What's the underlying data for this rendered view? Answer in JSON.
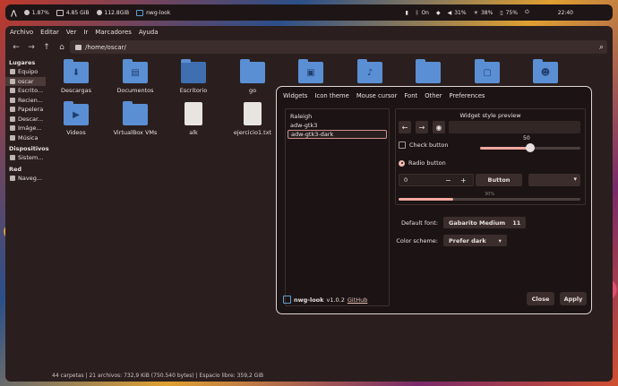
{
  "topbar": {
    "cpu": "1.87%",
    "memory": "4.85 GiB",
    "disk": "112.8GiB",
    "window_title": "nwg-look",
    "bluetooth": "On",
    "volume": "31%",
    "brightness": "38%",
    "battery": "75%",
    "clock": "22:40"
  },
  "filemanager": {
    "menu": [
      "Archivo",
      "Editar",
      "Ver",
      "Ir",
      "Marcadores",
      "Ayuda"
    ],
    "path": "/home/oscar/",
    "sidebar": {
      "places_header": "Lugares",
      "places": [
        "Equipo",
        "oscar",
        "Escrito...",
        "Recien...",
        "Papelera",
        "Descar...",
        "Imáge...",
        "Música"
      ],
      "devices_header": "Dispositivos",
      "devices": [
        "Sistem..."
      ],
      "network_header": "Red",
      "network": [
        "Naveg..."
      ]
    },
    "files": [
      "Descargas",
      "Documentos",
      "Escritorio",
      "go",
      "",
      "",
      "",
      "",
      "",
      "Videos",
      "VirtualBox VMs",
      "alk",
      "ejercicio1.txt"
    ],
    "status": "44 carpetas  |  21 archivos: 732,9 KiB (750.540 bytes)  |  Espacio libre: 359,2 GiB"
  },
  "dialog": {
    "tabs": [
      "Widgets",
      "Icon theme",
      "Mouse cursor",
      "Font",
      "Other",
      "Preferences"
    ],
    "themes": [
      "Raleigh",
      "adw-gtk3",
      "adw-gtk3-dark"
    ],
    "selected_theme_index": 2,
    "preview": {
      "title": "Widget style preview",
      "check_label": "Check button",
      "radio_label": "Radio button",
      "scale_value": "50",
      "scale_fraction": 0.5,
      "spin_value": "0",
      "button_label": "Button",
      "progress_label": "30%",
      "progress_fraction": 0.3
    },
    "default_font_label": "Default font:",
    "default_font_name": "Gabarito Medium",
    "default_font_size": "11",
    "color_scheme_label": "Color scheme:",
    "color_scheme_value": "Prefer dark",
    "app_name": "nwg-look",
    "version": "v1.0.2",
    "github_link": "GitHub",
    "close_label": "Close",
    "apply_label": "Apply"
  }
}
